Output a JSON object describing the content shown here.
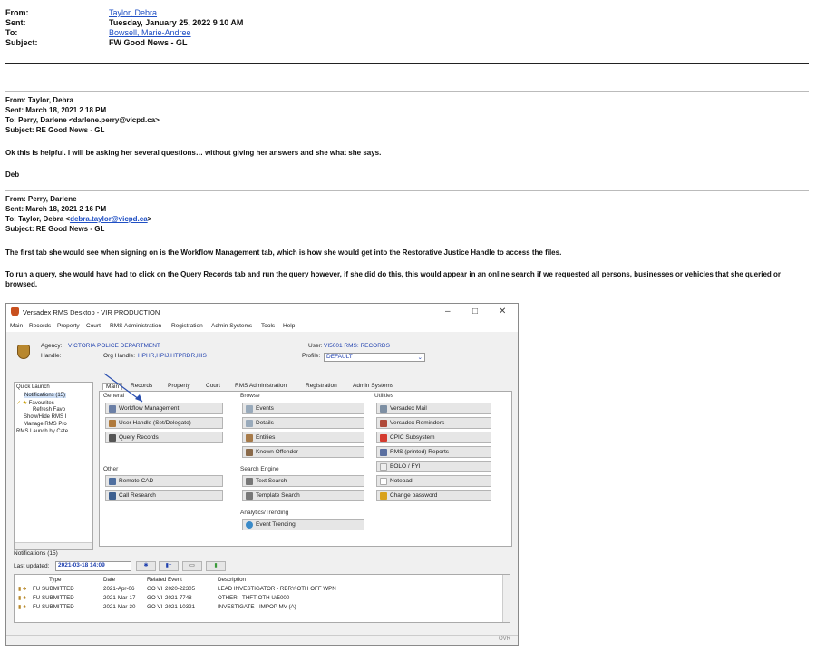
{
  "outer": {
    "from_label": "From:",
    "from": "Taylor, Debra",
    "sent_label": "Sent:",
    "sent": "Tuesday, January 25, 2022 9 10 AM",
    "to_label": "To:",
    "to": "Bowsell, Marie-Andree",
    "subject_label": "Subject:",
    "subject": "FW Good News - GL"
  },
  "email1": {
    "from": "From: Taylor, Debra",
    "sent": "Sent: March 18, 2021 2 18 PM",
    "to": "To: Perry, Darlene <darlene.perry@vicpd.ca>",
    "subject": "Subject: RE Good News - GL",
    "body": "Ok this is helpful.  I will be asking her several questions… without giving her answers and she what she says.",
    "signoff": "Deb"
  },
  "email2": {
    "from": "From: Perry, Darlene",
    "sent": "Sent: March 18, 2021 2 16 PM",
    "to_prefix": "To: Taylor, Debra <",
    "to_email": "debra.taylor@vicpd.ca",
    "to_suffix": ">",
    "subject": "Subject: RE Good News - GL",
    "para1": "The first tab she would see when signing on is the Workflow Management tab, which is how she would get into the Restorative Justice Handle to access the files.",
    "para2": "To run a query, she would have had to click on the Query Records tab and run the query however, if she did do this, this would appear in an online search if we requested all persons, businesses or vehicles that she queried or browsed."
  },
  "app": {
    "title": "Versadex RMS Desktop - VIR PRODUCTION",
    "menu": [
      "Main",
      "Records",
      "Property",
      "Court",
      "RMS Administration",
      "Registration",
      "Admin Systems",
      "Tools",
      "Help"
    ],
    "agency_label": "Agency:",
    "agency": "VICTORIA POLICE DEPARTMENT",
    "handle_label": "Handle:",
    "org_handle_label": "Org Handle:",
    "org_handle": "HPHR,HPIJ,HTPRDR,HIS",
    "user_label": "User:",
    "user": "VI5001 RMS: RECORDS",
    "profile_label": "Profile:",
    "profile": "DEFAULT",
    "quick_launch": {
      "title": "Quick Launch",
      "items": [
        "Notifications (15)",
        "Favourites",
        "Refresh Favo",
        "Show/Hide RMS I",
        "Manage RMS Pro",
        "RMS Launch by Cate"
      ]
    },
    "tabs": [
      "Main",
      "Records",
      "Property",
      "Court",
      "RMS Administration",
      "Registration",
      "Admin Systems"
    ],
    "groups": {
      "general": "General",
      "browse": "Browse",
      "utilities": "Utilities",
      "other": "Other",
      "search_engine": "Search Engine",
      "analytics": "Analytics/Trending"
    },
    "buttons": {
      "workflow": "Workflow Management",
      "user_handle": "User Handle (Set/Delegate)",
      "query_records": "Query Records",
      "events": "Events",
      "details": "Details",
      "entities": "Entities",
      "known_offender": "Known Offender",
      "versadex_mail": "Versadex Mail",
      "versadex_reminders": "Versadex Reminders",
      "cpic": "CPIC Subsystem",
      "rms_reports": "RMS (printed) Reports",
      "bolo": "BOLO / FYI",
      "notepad": "Notepad",
      "change_password": "Change password",
      "remote_cad": "Remote CAD",
      "call_research": "Call Research",
      "text_search": "Text Search",
      "template_search": "Template Search",
      "event_trending": "Event Trending"
    },
    "notifications_label": "Notifications (15)",
    "last_updated_label": "Last updated:",
    "last_updated": "2021-03-18 14:09",
    "grid_headers": [
      "Type",
      "Date",
      "Related Event",
      "Description"
    ],
    "rows": [
      {
        "type": "FU SUBMITTED",
        "date": "2021-Apr-06",
        "go": "GO VI",
        "event": "2020-22305",
        "desc": "LEAD INVESTIGATOR - RBRY-OTH OFF WPN"
      },
      {
        "type": "FU SUBMITTED",
        "date": "2021-Mar-17",
        "go": "GO VI",
        "event": "2021-7748",
        "desc": "OTHER - THFT-OTH U/5000"
      },
      {
        "type": "FU SUBMITTED",
        "date": "2021-Mar-30",
        "go": "GO VI",
        "event": "2021-10321",
        "desc": "INVESTIGATE - IMPOP MV (A)"
      }
    ],
    "status_ovr": "OVR",
    "colors": {
      "link": "#1f4fc4",
      "app_blue": "#1e3fae"
    }
  }
}
